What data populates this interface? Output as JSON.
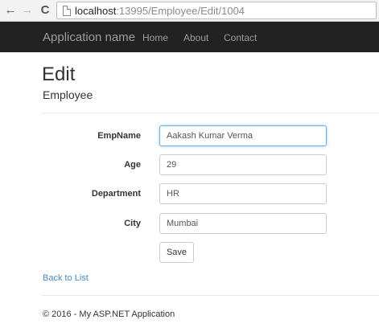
{
  "browser": {
    "back_icon": "←",
    "forward_icon": "→",
    "reload_icon": "C",
    "url_host": "localhost",
    "url_path": ":13995/Employee/Edit/1004"
  },
  "navbar": {
    "brand": "Application name",
    "links": [
      "Home",
      "About",
      "Contact"
    ],
    "background": "#222222"
  },
  "page": {
    "title": "Edit",
    "subtitle": "Employee"
  },
  "form": {
    "fields": [
      {
        "label": "EmpName",
        "value": "Aakash Kumar Verma"
      },
      {
        "label": "Age",
        "value": "29"
      },
      {
        "label": "Department",
        "value": "HR"
      },
      {
        "label": "City",
        "value": "Mumbai"
      }
    ],
    "save_label": "Save"
  },
  "back_link": "Back to List",
  "footer": "© 2016 - My ASP.NET Application",
  "colors": {
    "link": "#428bca",
    "focus_border": "#66afe9"
  }
}
